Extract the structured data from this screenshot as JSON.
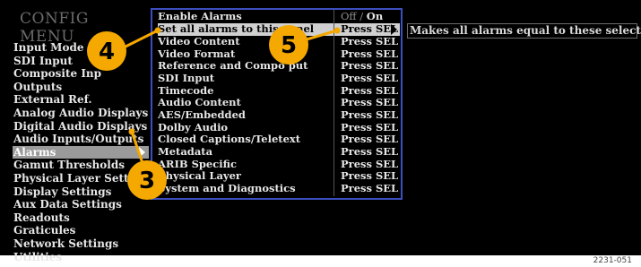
{
  "menu": {
    "title": "CONFIG MENU"
  },
  "left_menu": {
    "items": [
      {
        "label": "Input Mode"
      },
      {
        "label": "SDI Input"
      },
      {
        "label": "Composite Inp"
      },
      {
        "label": "Outputs"
      },
      {
        "label": "External Ref."
      },
      {
        "label": "Analog Audio Displays"
      },
      {
        "label": "Digital Audio Displays"
      },
      {
        "label": "Audio Inputs/Outputs"
      },
      {
        "label": "Alarms",
        "selected": true
      },
      {
        "label": "Gamut Thresholds"
      },
      {
        "label": "Physical Layer Settin"
      },
      {
        "label": "Display Settings"
      },
      {
        "label": "Aux Data Settings"
      },
      {
        "label": "Readouts"
      },
      {
        "label": "Graticules"
      },
      {
        "label": "Network Settings"
      },
      {
        "label": "Utilities"
      }
    ]
  },
  "submenu": {
    "enable_alarms": {
      "label": "Enable Alarms",
      "value_off": "Off",
      "value_sep": " / ",
      "value_on": "On"
    },
    "rows": [
      {
        "label": "Set all alarms to this panel",
        "value": "Press SEL",
        "selected": true
      },
      {
        "label": "Video Content",
        "value": "Press SEL"
      },
      {
        "label": "Video Format",
        "value": "Press SEL"
      },
      {
        "label": "Reference and Compo    put",
        "value": "Press SEL"
      },
      {
        "label": "SDI Input",
        "value": "Press SEL"
      },
      {
        "label": "Timecode",
        "value": "Press SEL"
      },
      {
        "label": "Audio Content",
        "value": "Press SEL"
      },
      {
        "label": "AES/Embedded",
        "value": "Press SEL"
      },
      {
        "label": "Dolby Audio",
        "value": "Press SEL"
      },
      {
        "label": "Closed Captions/Teletext",
        "value": "Press SEL"
      },
      {
        "label": "Metadata",
        "value": "Press SEL"
      },
      {
        "label": "ARIB Specific",
        "value": "Press SEL"
      },
      {
        "label": "Physical Layer",
        "value": "Press SEL"
      },
      {
        "label": "System and Diagnostics",
        "value": "Press SEL"
      }
    ]
  },
  "help": {
    "text": "Makes all alarms equal to these selections"
  },
  "callouts": {
    "c3": "3",
    "c4": "4",
    "c5": "5"
  },
  "figure_id": "2231-051",
  "colors": {
    "screen_bg": "#000000",
    "callout_fill": "#f5a800",
    "box_border": "#3b4fbf"
  }
}
